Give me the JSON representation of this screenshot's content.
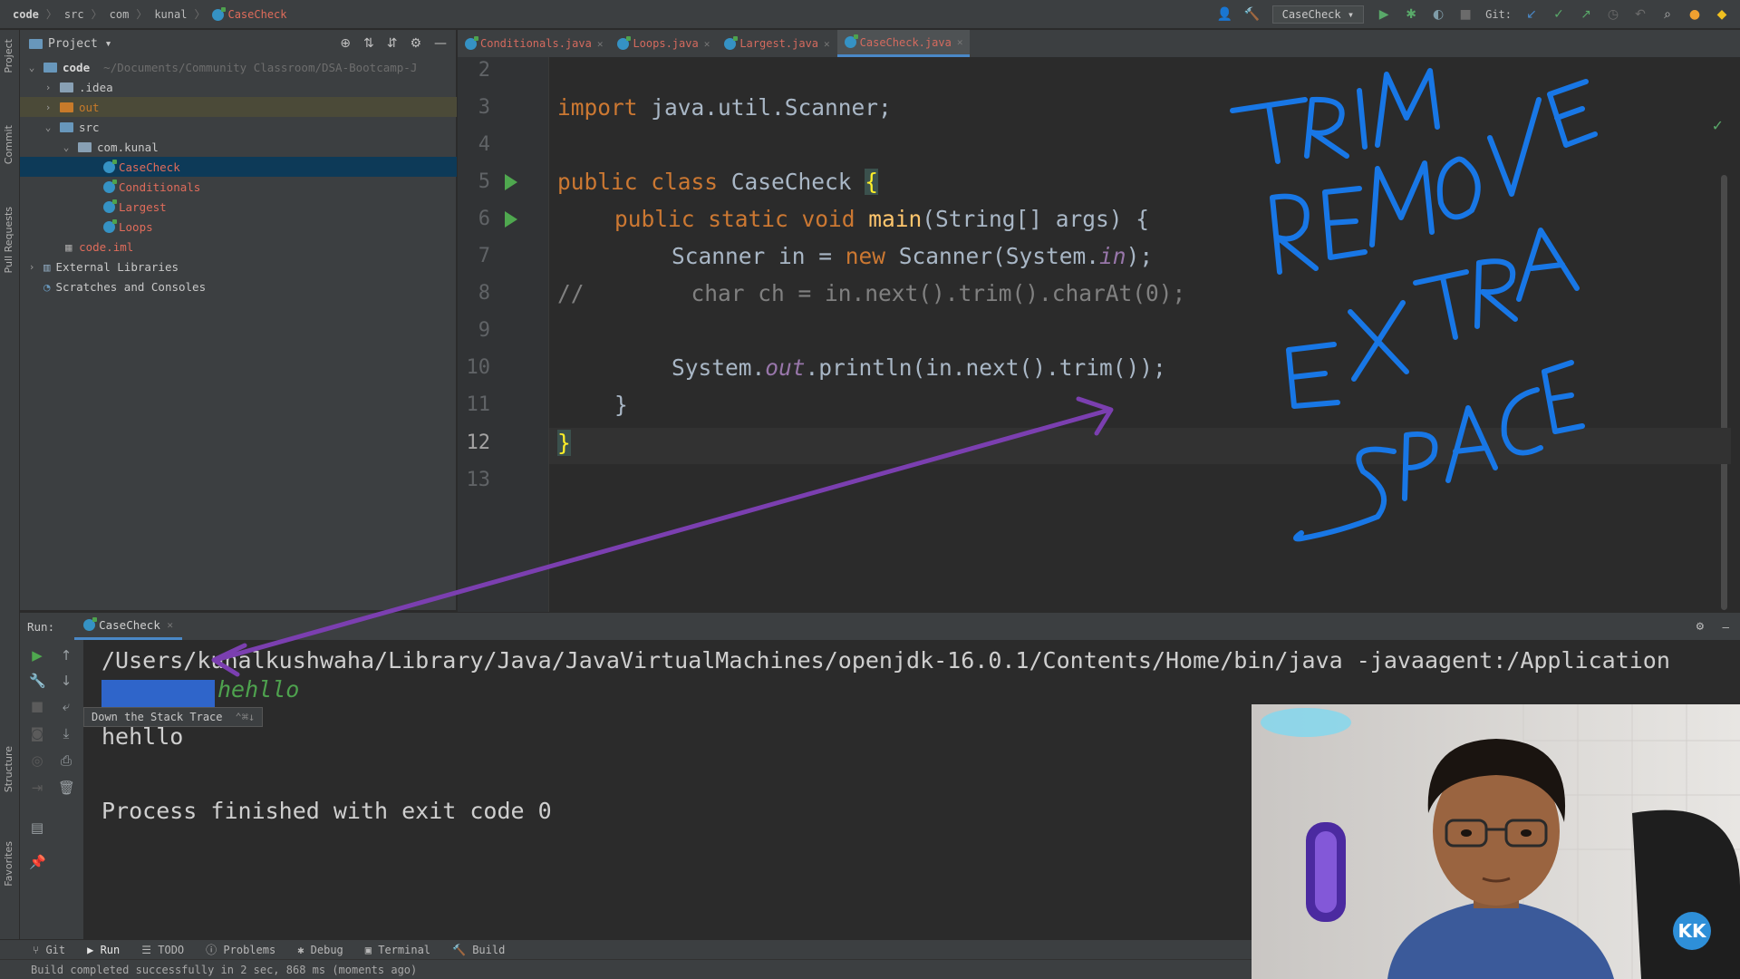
{
  "breadcrumb": [
    "code",
    "src",
    "com",
    "kunal",
    "CaseCheck"
  ],
  "toolbar": {
    "run_config": "CaseCheck",
    "git_label": "Git:"
  },
  "left_strip": {
    "project": "Project",
    "commit": "Commit",
    "pull_requests": "Pull Requests",
    "structure": "Structure",
    "favorites": "Favorites"
  },
  "project": {
    "header": "Project",
    "tree": [
      {
        "label": "code",
        "extra": "~/Documents/Community Classroom/DSA-Bootcamp-J"
      },
      {
        "label": ".idea"
      },
      {
        "label": "out"
      },
      {
        "label": "src"
      },
      {
        "label": "com.kunal"
      },
      {
        "label": "CaseCheck"
      },
      {
        "label": "Conditionals"
      },
      {
        "label": "Largest"
      },
      {
        "label": "Loops"
      },
      {
        "label": "code.iml"
      },
      {
        "label": "External Libraries"
      },
      {
        "label": "Scratches and Consoles"
      }
    ]
  },
  "tabs": [
    "Conditionals.java",
    "Loops.java",
    "Largest.java",
    "CaseCheck.java"
  ],
  "editor": {
    "line_numbers": [
      "2",
      "3",
      "4",
      "5",
      "6",
      "7",
      "8",
      "9",
      "10",
      "11",
      "12",
      "13"
    ],
    "l3_kw": "import",
    "l3_rest": " java.util.Scanner;",
    "l5_kw": "public class",
    "l5_name": " CaseCheck ",
    "l5_brace": "{",
    "l6_kw": "public static void",
    "l6_fn": " main",
    "l6_rest": "(String[] args) {",
    "l7_a": "Scanner in = ",
    "l7_kw": "new",
    "l7_b": " Scanner(System.",
    "l7_st": "in",
    "l7_c": ");",
    "l8_comment": "//        char ch = in.next().trim().charAt(0);",
    "l10_a": "System.",
    "l10_st": "out",
    "l10_b": ".println(in.next().trim());",
    "l11": "}",
    "l12": "}"
  },
  "run": {
    "label": "Run:",
    "tab": "CaseCheck",
    "console_cmd": "/Users/kunalkushwaha/Library/Java/JavaVirtualMachines/openjdk-16.0.1/Contents/Home/bin/java -javaagent:/Application",
    "green_input": "hehllo",
    "output_line": "hehllo",
    "exit_line": "Process finished with exit code 0",
    "tooltip": "Down the Stack Trace",
    "tooltip_key": "⌃⌘↓"
  },
  "bottom_tools": [
    "Git",
    "Run",
    "TODO",
    "Problems",
    "Debug",
    "Terminal",
    "Build"
  ],
  "status": "Build completed successfully in 2 sec, 868 ms (moments ago)",
  "annotation": {
    "line1": "TRIM",
    "line2": "REMOVE",
    "line3": "EXTRA",
    "line4": "SPACE"
  },
  "channel_badge": "KK",
  "colors": {
    "keyword": "#cc7832",
    "method": "#ffc66d",
    "static_field": "#9876aa",
    "handwriting": "#1877e6",
    "arrow": "#7b3fb0"
  }
}
